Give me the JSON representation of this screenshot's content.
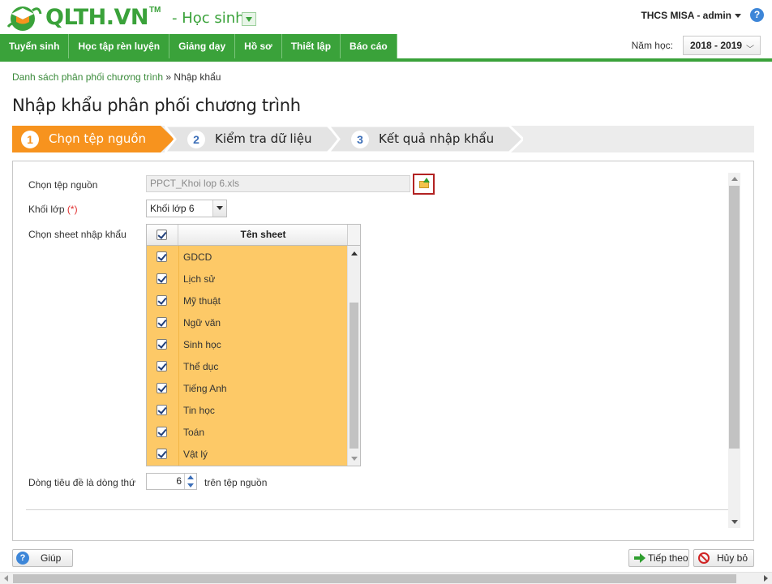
{
  "header": {
    "brand": "QLTH.VN",
    "brand_tm": "TM",
    "module": "- Học sinh",
    "user": "THCS MISA - admin",
    "help_glyph": "?",
    "colors": {
      "brand_green": "#3aa23a",
      "accent_orange": "#f7931e",
      "help_blue": "#3d86d8"
    }
  },
  "nav": {
    "items": [
      "Tuyển sinh",
      "Học tập rèn luyện",
      "Giảng dạy",
      "Hồ sơ",
      "Thiết lập",
      "Báo cáo"
    ],
    "year_label": "Năm học:",
    "year_value": "2018 - 2019",
    "year_caret": "﹀"
  },
  "breadcrumb": {
    "parent": "Danh sách phân phối chương trình",
    "separator": "»",
    "current": "Nhập khẩu"
  },
  "page_title": "Nhập khẩu phân phối chương trình",
  "wizard": {
    "steps": [
      {
        "num": "1",
        "label": "Chọn tệp nguồn",
        "active": true
      },
      {
        "num": "2",
        "label": "Kiểm tra dữ liệu",
        "active": false
      },
      {
        "num": "3",
        "label": "Kết quả nhập khẩu",
        "active": false
      }
    ]
  },
  "form": {
    "source_label": "Chọn tệp nguồn",
    "source_file": "PPCT_Khoi lop 6.xls",
    "grade_label": "Khối lớp",
    "required_mark": "(*)",
    "grade_value": "Khối lớp 6",
    "sheet_label": "Chọn sheet nhập khẩu",
    "sheet_header": "Tên sheet",
    "sheets": [
      "GDCD",
      "Lịch sử",
      "Mỹ thuật",
      "Ngữ văn",
      "Sinh học",
      "Thể dục",
      "Tiếng Anh",
      "Tin học",
      "Toán",
      "Vật lý"
    ],
    "header_row_label": "Dòng tiêu đề là dòng thứ",
    "header_row_value": "6",
    "header_row_suffix": "trên tệp nguồn"
  },
  "footer": {
    "help": "Giúp",
    "next": "Tiếp theo",
    "cancel": "Hủy bỏ"
  },
  "icons": [
    "logo-icon",
    "chevron-down-icon",
    "help-icon",
    "folder-open-icon",
    "checkbox-icon",
    "arrow-right-icon",
    "cancel-icon"
  ]
}
